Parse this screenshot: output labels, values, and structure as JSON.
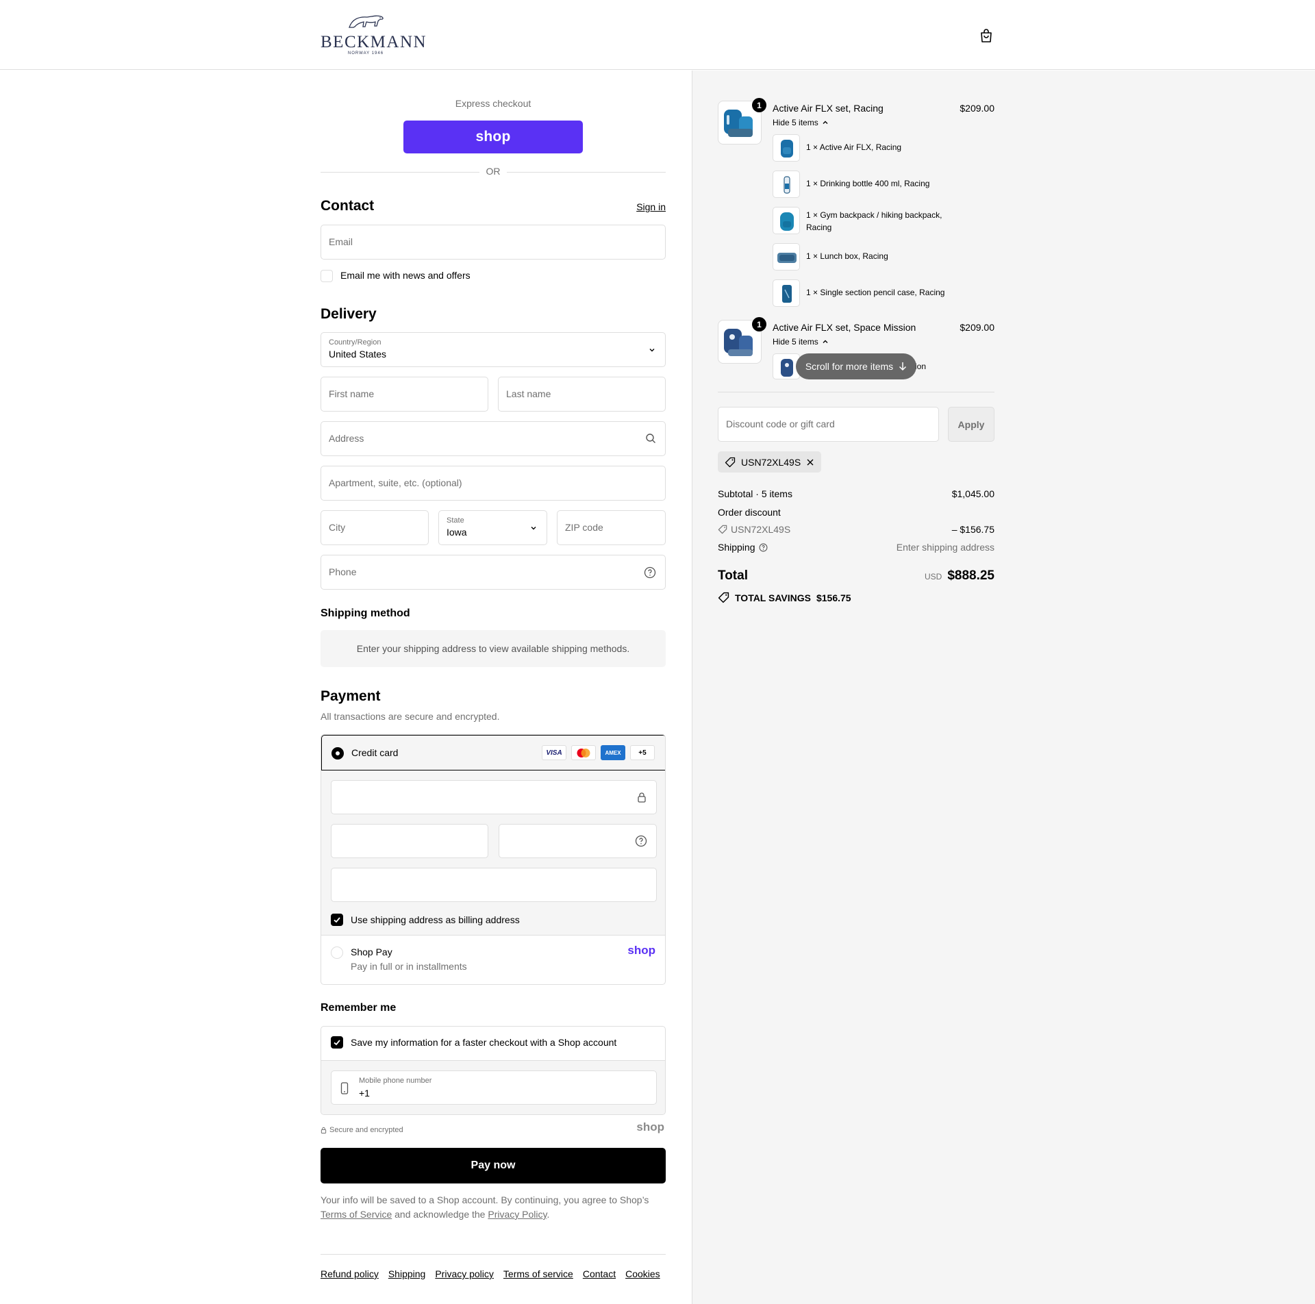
{
  "header": {
    "brand": "BECKMANN",
    "brand_sub": "NORWAY 1946"
  },
  "express": {
    "label": "Express checkout",
    "shop_button": "shop",
    "or": "OR"
  },
  "contact": {
    "title": "Contact",
    "sign_in": "Sign in",
    "email_placeholder": "Email",
    "news_label": "Email me with news and offers"
  },
  "delivery": {
    "title": "Delivery",
    "country_label": "Country/Region",
    "country_value": "United States",
    "first_name": "First name",
    "last_name": "Last name",
    "address": "Address",
    "apartment": "Apartment, suite, etc. (optional)",
    "city": "City",
    "state_label": "State",
    "state_value": "Iowa",
    "zip": "ZIP code",
    "phone": "Phone"
  },
  "shipping_method": {
    "title": "Shipping method",
    "info": "Enter your shipping address to view available shipping methods."
  },
  "payment": {
    "title": "Payment",
    "subtitle": "All transactions are secure and encrypted.",
    "credit_card": "Credit card",
    "cards": [
      "VISA",
      "MC",
      "AMEX",
      "+5"
    ],
    "billing_label": "Use shipping address as billing address",
    "shop_pay": "Shop Pay",
    "shop_pay_sub": "Pay in full or in installments",
    "shop_pay_logo": "shop"
  },
  "remember": {
    "title": "Remember me",
    "save_label": "Save my information for a faster checkout with a Shop account",
    "mobile_label": "Mobile phone number",
    "mobile_value": "+1",
    "secure": "Secure and encrypted",
    "shop_logo": "shop"
  },
  "pay_now": "Pay now",
  "legal": {
    "line1": "Your info will be saved to a Shop account. By continuing, you agree to Shop’s",
    "terms": "Terms of Service",
    "middle": "and acknowledge the",
    "privacy": "Privacy Policy",
    "end": "."
  },
  "footer": [
    "Refund policy",
    "Shipping",
    "Privacy policy",
    "Terms of service",
    "Contact",
    "Cookies"
  ],
  "summary": {
    "products": [
      {
        "name": "Active Air FLX set, Racing",
        "price": "$209.00",
        "qty": "1",
        "toggle": "Hide 5 items",
        "items": [
          "1 × Active Air FLX, Racing",
          "1 × Drinking bottle 400 ml, Racing",
          "1 × Gym backpack / hiking backpack, Racing",
          "1 × Lunch box, Racing",
          "1 × Single section pencil case, Racing"
        ]
      },
      {
        "name": "Active Air FLX set, Space Mission",
        "price": "$209.00",
        "qty": "1",
        "toggle": "Hide 5 items",
        "items": [
          "ion"
        ]
      }
    ],
    "scroll_hint": "Scroll for more items",
    "discount_placeholder": "Discount code or gift card",
    "apply": "Apply",
    "code": "USN72XL49S",
    "subtotal_label": "Subtotal · 5 items",
    "subtotal_value": "$1,045.00",
    "order_discount": "Order discount",
    "discount_code": "USN72XL49S",
    "discount_value": "– $156.75",
    "shipping_label": "Shipping",
    "shipping_value": "Enter shipping address",
    "total_label": "Total",
    "currency": "USD",
    "total_value": "$888.25",
    "savings_label": "TOTAL SAVINGS",
    "savings_value": "$156.75"
  },
  "colors": {
    "shop_purple": "#5a31f4",
    "accent_black": "#000000",
    "summary_bg": "#f5f5f5",
    "border": "#dedede",
    "amex_blue": "#1f72cd"
  }
}
